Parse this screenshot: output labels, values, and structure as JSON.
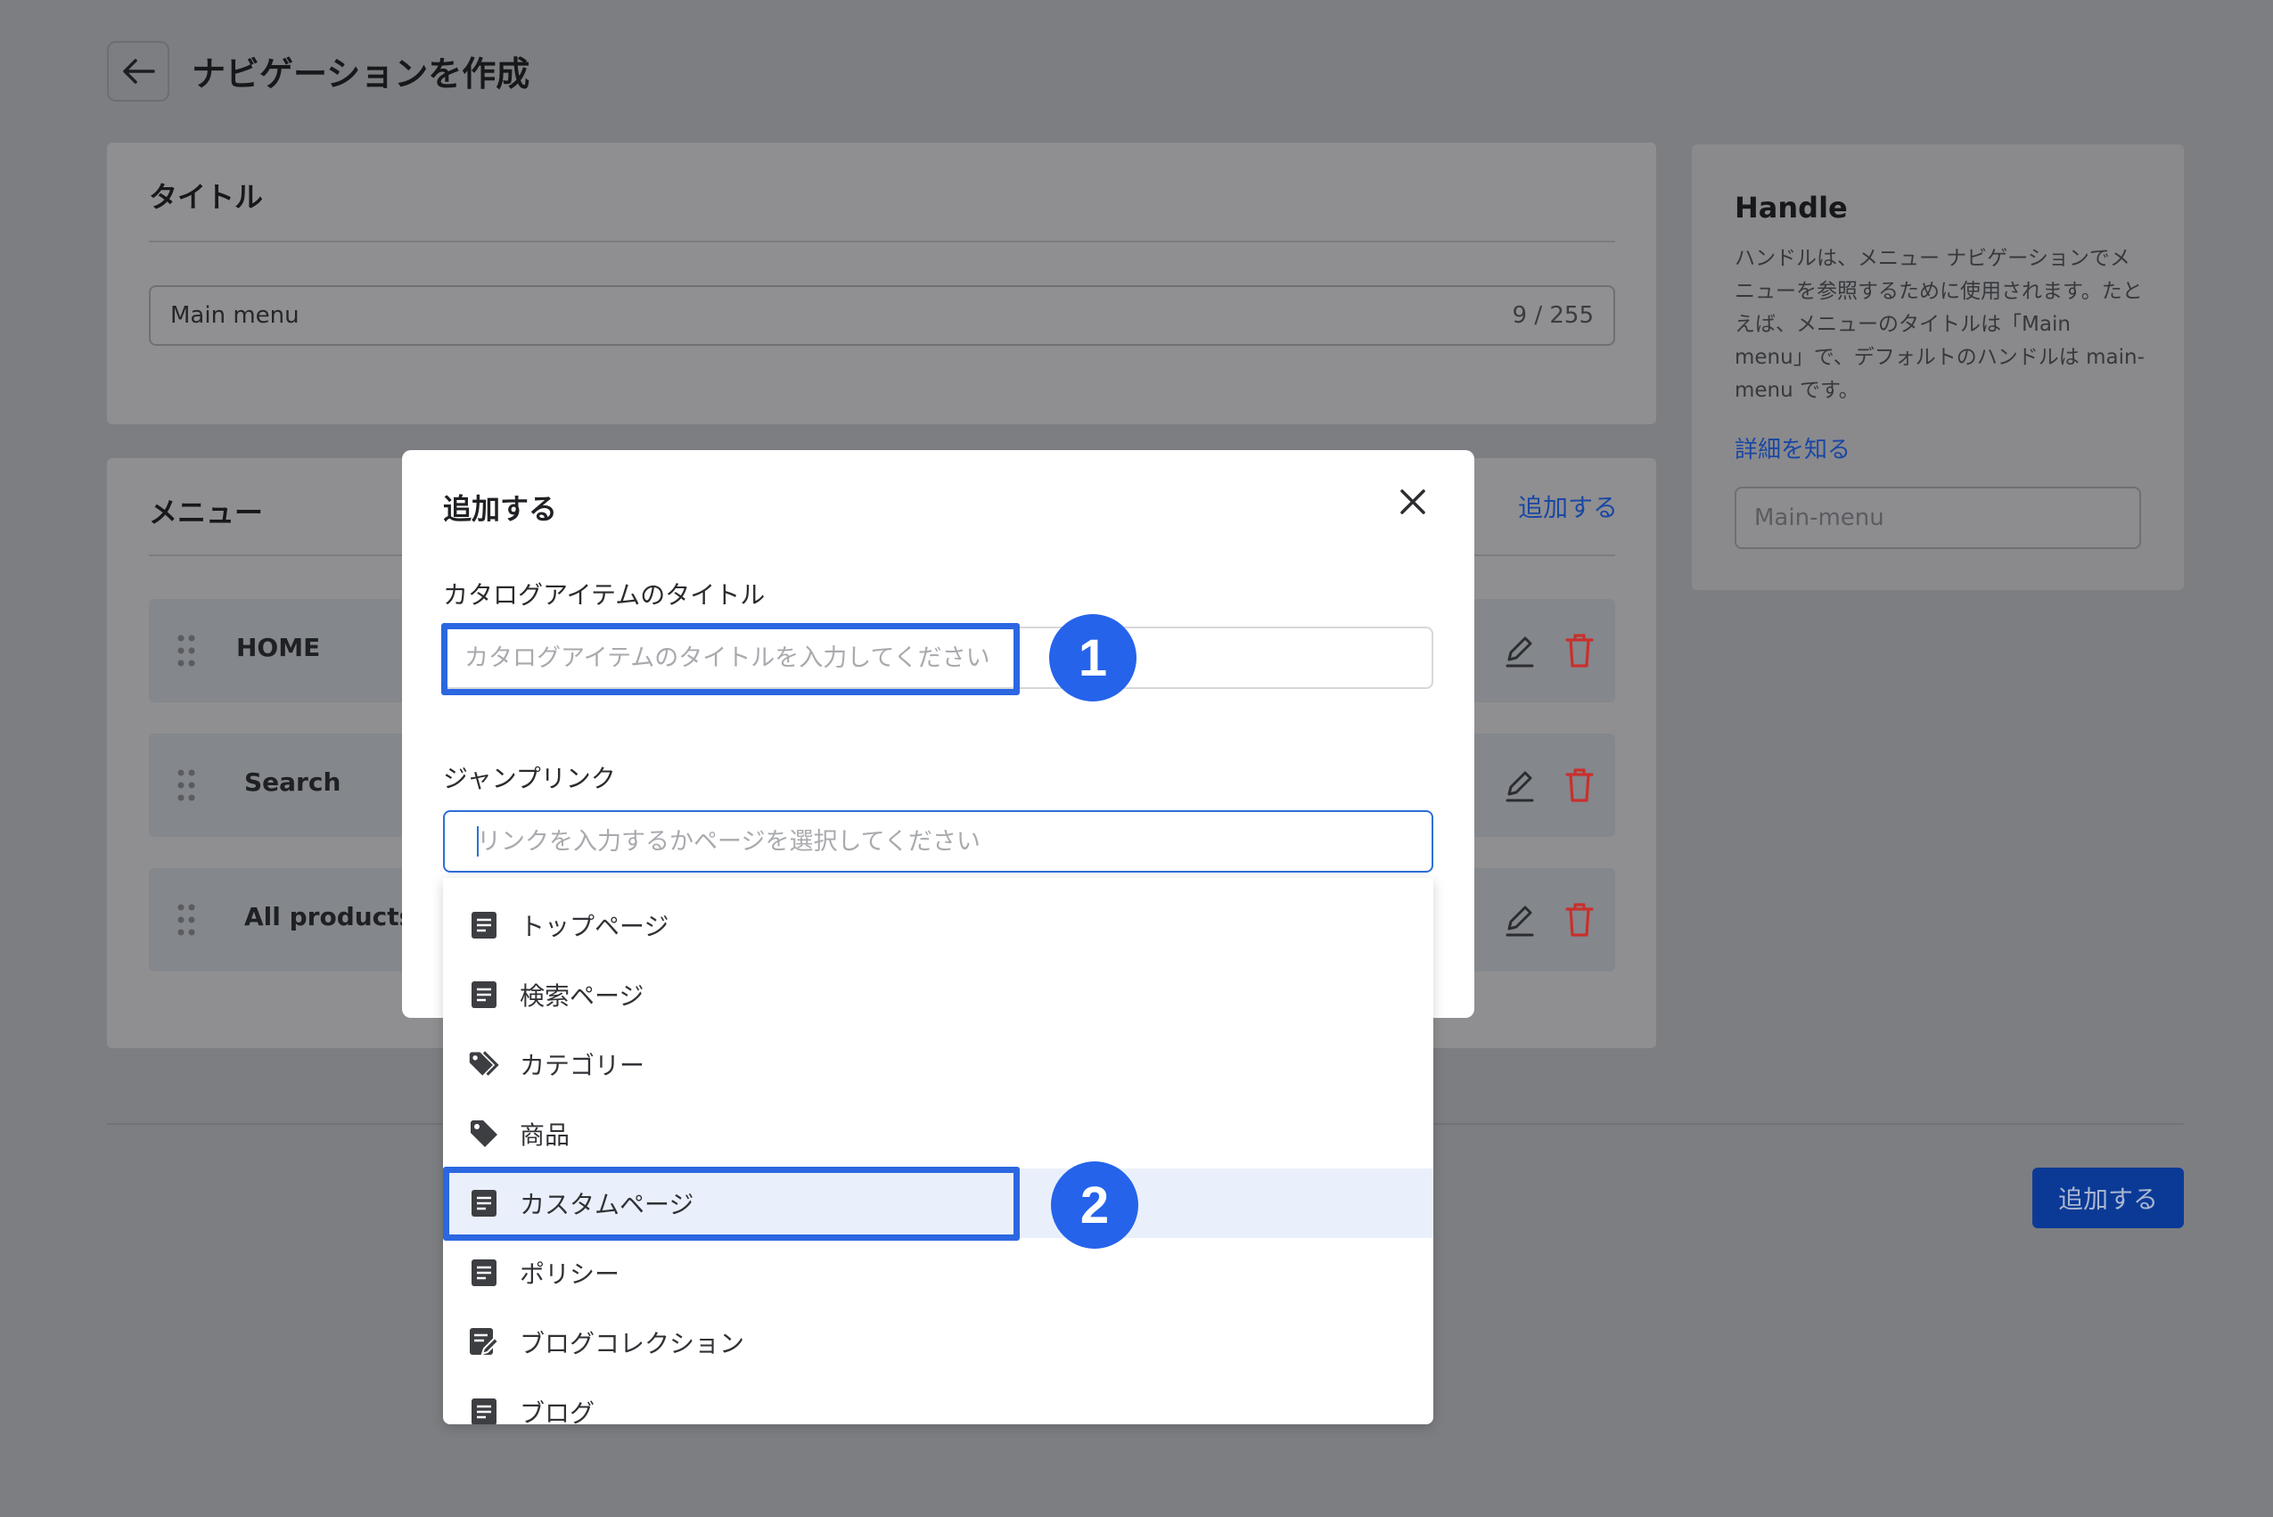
{
  "page": {
    "title": "ナビゲーションを作成",
    "back_icon": "arrow-left-icon"
  },
  "title_card": {
    "heading": "タイトル",
    "input_value": "Main menu",
    "char_count": "9 / 255"
  },
  "menu_card": {
    "heading": "メニュー",
    "add_link": "追加する",
    "items": [
      {
        "label": "HOME"
      },
      {
        "label": "Search"
      },
      {
        "label": "All products"
      }
    ]
  },
  "handle_card": {
    "heading": "Handle",
    "description": "ハンドルは、メニュー ナビゲーションでメニューを参照するために使用されます。たとえば、メニューのタイトルは「Main menu」で、デフォルトのハンドルは main-menu です。",
    "learn_more": "詳細を知る",
    "input_placeholder": "Main-menu"
  },
  "footer": {
    "add_button": "追加する"
  },
  "modal": {
    "title": "追加する",
    "catalog_title_label": "カタログアイテムのタイトル",
    "catalog_title_placeholder": "カタログアイテムのタイトルを入力してください",
    "jump_link_label": "ジャンプリンク",
    "jump_link_placeholder": "リンクを入力するかページを選択してください",
    "options": [
      {
        "label": "トップページ",
        "icon": "page-icon"
      },
      {
        "label": "検索ページ",
        "icon": "page-icon"
      },
      {
        "label": "カテゴリー",
        "icon": "tags-icon"
      },
      {
        "label": "商品",
        "icon": "tag-icon"
      },
      {
        "label": "カスタムページ",
        "icon": "page-icon",
        "selected": true
      },
      {
        "label": "ポリシー",
        "icon": "page-icon"
      },
      {
        "label": "ブログコレクション",
        "icon": "page-edit-icon"
      },
      {
        "label": "ブログ",
        "icon": "page-icon"
      }
    ]
  },
  "annotations": {
    "step_1": "1",
    "step_2": "2",
    "accent_color": "#2563eb"
  }
}
